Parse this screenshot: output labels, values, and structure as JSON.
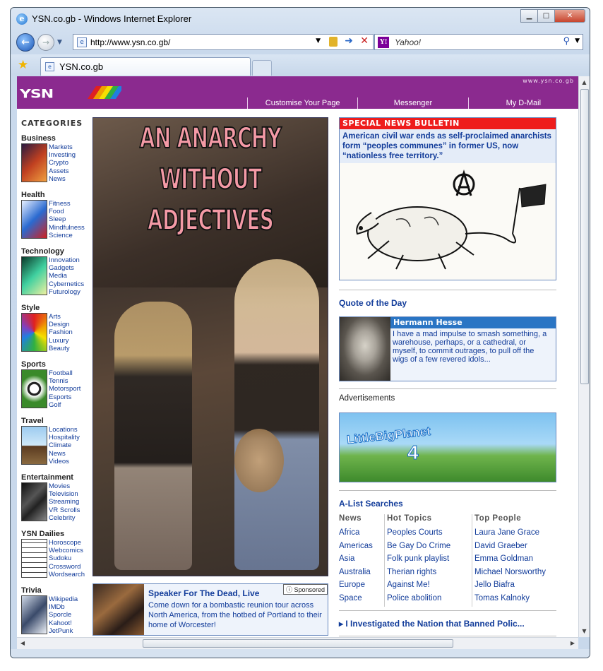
{
  "window": {
    "title": "YSN.co.gb - Windows Internet Explorer",
    "address": "http://www.ysn.co.gb/",
    "search_placeholder": "Yahoo!",
    "tab_label": "YSN.co.gb"
  },
  "header": {
    "logo": "YSN",
    "domain": "www.ysn.co.gb",
    "nav": [
      "Customise Your Page",
      "Messenger",
      "My D-Mail"
    ]
  },
  "categories": {
    "heading": "CATEGORIES",
    "groups": [
      {
        "name": "Business",
        "items": [
          "Markets",
          "Investing",
          "Crypto",
          "Assets",
          "News"
        ]
      },
      {
        "name": "Health",
        "items": [
          "Fitness",
          "Food",
          "Sleep",
          "Mindfulness",
          "Science"
        ]
      },
      {
        "name": "Technology",
        "items": [
          "Innovation",
          "Gadgets",
          "Media",
          "Cybernetics",
          "Futurology"
        ]
      },
      {
        "name": "Style",
        "items": [
          "Arts",
          "Design",
          "Fashion",
          "Luxury",
          "Beauty"
        ]
      },
      {
        "name": "Sports",
        "items": [
          "Football",
          "Tennis",
          "Motorsport",
          "Esports",
          "Golf"
        ]
      },
      {
        "name": "Travel",
        "items": [
          "Locations",
          "Hospitality",
          "Climate",
          "News",
          "Videos"
        ]
      },
      {
        "name": "Entertainment",
        "items": [
          "Movies",
          "Television",
          "Streaming",
          "VR Scrolls",
          "Celebrity"
        ]
      },
      {
        "name": "YSN Dailies",
        "items": [
          "Horoscope",
          "Webcomics",
          "Sudoku",
          "Crossword",
          "Wordsearch"
        ]
      },
      {
        "name": "Trivia",
        "items": [
          "Wikipedia",
          "IMDb",
          "Sporcle",
          "Kahoot!",
          "JetPunk"
        ]
      }
    ]
  },
  "hero": {
    "line1": "AN ANARCHY",
    "line2": "WITHOUT",
    "line3": "ADJECTIVES"
  },
  "sponsored": {
    "badge": "Sponsored",
    "title": "Speaker For The Dead, Live",
    "body": "Come down for a bombastic reunion tour across North America, from the hotbed of Portland to their home of Worcester!"
  },
  "bulletin": {
    "heading": "SPECIAL NEWS BULLETIN",
    "text": "American civil war ends as self-proclaimed anarchists form “peoples communes” in former US, now “nationless free territory.”"
  },
  "quote": {
    "heading": "Quote of the Day",
    "author": "Hermann Hesse",
    "text": "I have a mad impulse to smash something, a warehouse, perhaps, or a cathedral, or myself, to commit outrages, to pull off the wigs of a few revered idols..."
  },
  "ads": {
    "heading": "Advertisements",
    "ad_title": "LittleBigPlanet",
    "ad_number": "4"
  },
  "alist": {
    "heading": "A-List Searches",
    "columns": [
      {
        "header": "News",
        "items": [
          "Africa",
          "Americas",
          "Asia",
          "Australia",
          "Europe",
          "Space"
        ]
      },
      {
        "header": "Hot Topics",
        "items": [
          "Peoples Courts",
          "Be Gay Do Crime",
          "Folk punk playlist",
          "Therian rights",
          "Against Me!",
          "Police abolition"
        ]
      },
      {
        "header": "Top People",
        "items": [
          "Laura Jane Grace",
          "David Graeber",
          "Emma Goldman",
          "Michael Norsworthy",
          "Jello Biafra",
          "Tomas Kalnoky"
        ]
      }
    ]
  },
  "investigation": "I Investigated the Nation that Banned Polic..."
}
